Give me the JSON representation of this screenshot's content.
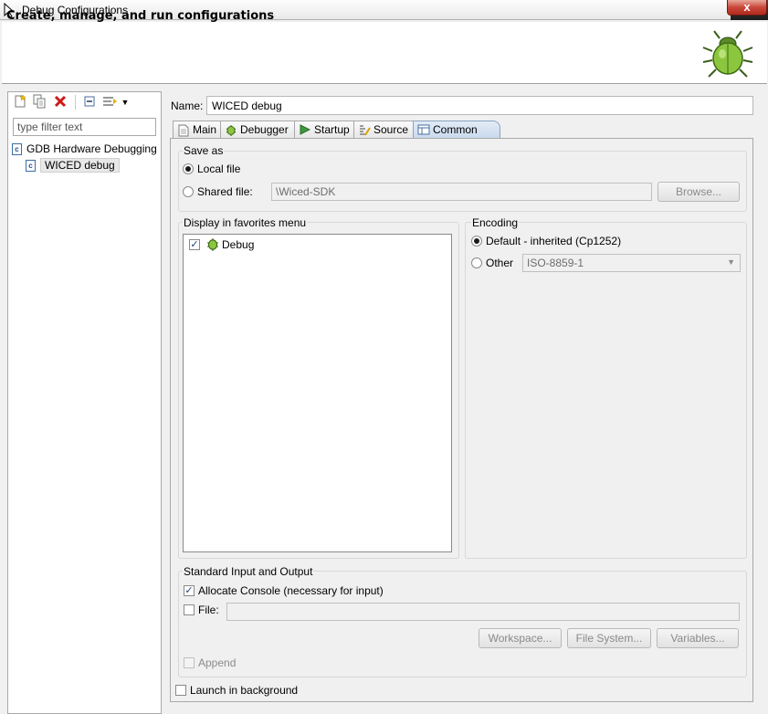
{
  "window": {
    "title": "Debug Configurations",
    "close_glyph": "x"
  },
  "banner": {
    "heading": "Create, manage, and run configurations",
    "image_icon": "bug-icon"
  },
  "left": {
    "toolbar": {
      "icons": [
        "new-configuration-icon",
        "duplicate-icon",
        "delete-icon",
        "collapse-all-icon",
        "filter-icon",
        "dropdown-arrow-icon"
      ]
    },
    "filter": {
      "placeholder": "type filter text",
      "value": ""
    },
    "tree": [
      {
        "label": "GDB Hardware Debugging",
        "icon": "c-config-type-icon",
        "level": 0
      },
      {
        "label": "WICED debug",
        "icon": "c-config-icon",
        "level": 1,
        "selected": true
      }
    ]
  },
  "main": {
    "name_label": "Name:",
    "name_value": "WICED debug",
    "tabs": [
      {
        "label": "Main",
        "icon": "page-icon"
      },
      {
        "label": "Debugger",
        "icon": "bug-icon"
      },
      {
        "label": "Startup",
        "icon": "play-icon"
      },
      {
        "label": "Source",
        "icon": "source-icon"
      },
      {
        "label": "Common",
        "icon": "common-icon",
        "active": true
      }
    ],
    "save_as": {
      "title": "Save as",
      "local_label": "Local file",
      "local_selected": true,
      "shared_label": "Shared file:",
      "shared_value": "\\Wiced-SDK",
      "browse_label": "Browse..."
    },
    "favorites": {
      "title": "Display in favorites menu",
      "items": [
        {
          "label": "Debug",
          "checked": true,
          "icon": "bug-icon"
        }
      ]
    },
    "encoding": {
      "title": "Encoding",
      "default_label": "Default - inherited (Cp1252)",
      "default_selected": true,
      "other_label": "Other",
      "other_value": "ISO-8859-1"
    },
    "std_io": {
      "title": "Standard Input and Output",
      "allocate_label": "Allocate Console (necessary for input)",
      "allocate_checked": true,
      "file_label": "File:",
      "file_checked": false,
      "file_value": "",
      "workspace_label": "Workspace...",
      "filesystem_label": "File System...",
      "variables_label": "Variables...",
      "append_label": "Append",
      "append_checked": false
    },
    "launch_bg_label": "Launch in background",
    "launch_bg_checked": false
  }
}
